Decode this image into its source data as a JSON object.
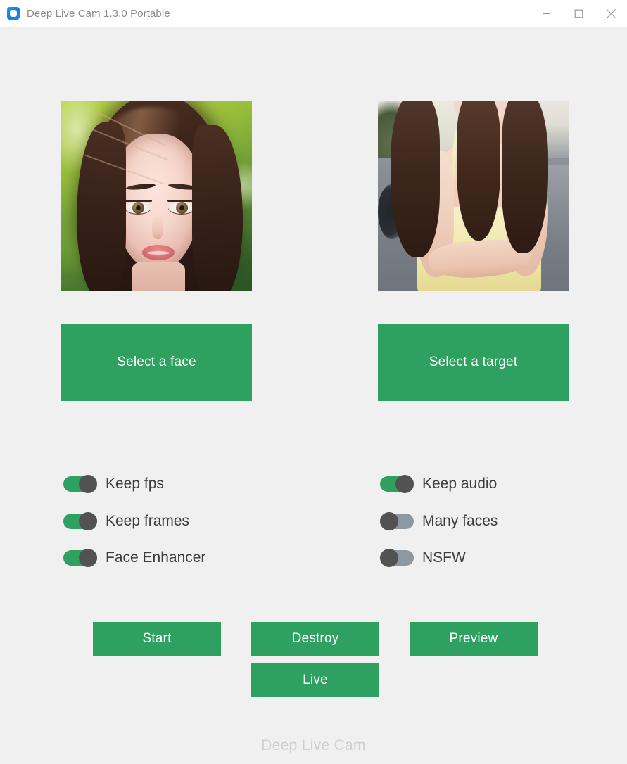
{
  "window": {
    "title": "Deep Live Cam 1.3.0 Portable",
    "icon": "app-logo-icon",
    "controls": {
      "minimize": "minimize-icon",
      "maximize": "maximize-icon",
      "close": "close-icon"
    }
  },
  "theme": {
    "background": "#f0f0f0",
    "titlebar_background": "#ffffff",
    "accent_green": "#2ea05f",
    "switch_off_track": "#8d98a3",
    "switch_knob": "#525252",
    "label_text": "#3c3c3c",
    "title_text": "#8b8b8b",
    "footer_text": "#cfcfcf"
  },
  "previews": {
    "source": {
      "name": "source-face-preview",
      "description": "Portrait of a woman with long dark brown hair against sunlit green foliage"
    },
    "target": {
      "name": "target-media-preview",
      "description": "Woman in a pale yellow camisole dress with long brown hair sitting on a gray bed"
    }
  },
  "select_buttons": {
    "face": "Select a face",
    "target": "Select a target"
  },
  "switches": {
    "left": [
      {
        "id": "keep-fps",
        "label": "Keep fps",
        "state": "on"
      },
      {
        "id": "keep-frames",
        "label": "Keep frames",
        "state": "on"
      },
      {
        "id": "face-enhancer",
        "label": "Face Enhancer",
        "state": "on"
      }
    ],
    "right": [
      {
        "id": "keep-audio",
        "label": "Keep audio",
        "state": "on"
      },
      {
        "id": "many-faces",
        "label": "Many faces",
        "state": "off"
      },
      {
        "id": "nsfw",
        "label": "NSFW",
        "state": "off"
      }
    ]
  },
  "actions": {
    "start": "Start",
    "destroy": "Destroy",
    "preview": "Preview",
    "live": "Live"
  },
  "footer": {
    "status": "Deep Live Cam"
  }
}
